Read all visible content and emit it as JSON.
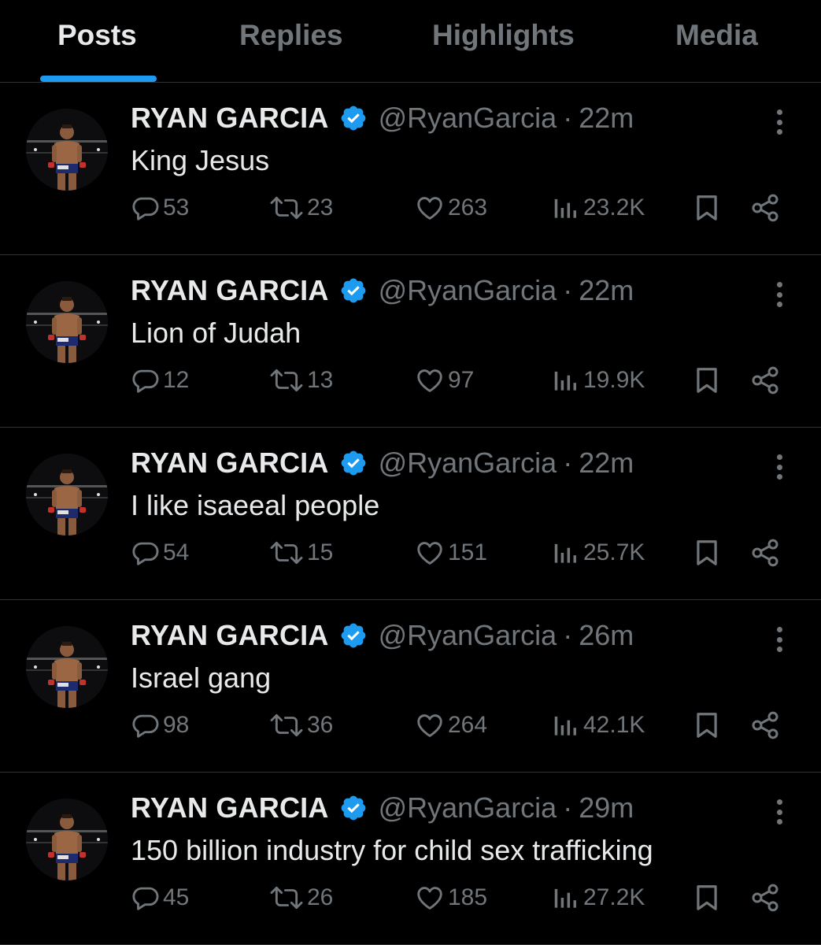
{
  "tabs": [
    {
      "label": "Posts",
      "active": true
    },
    {
      "label": "Replies",
      "active": false
    },
    {
      "label": "Highlights",
      "active": false
    },
    {
      "label": "Media",
      "active": false
    }
  ],
  "colors": {
    "accent": "#1d9bf0",
    "background": "#000000",
    "muted": "#71767b",
    "text": "#e7e9ea"
  },
  "posts": [
    {
      "name": "RYAN GARCIA",
      "handle": "@RyanGarcia",
      "time": "22m",
      "text": "King Jesus",
      "replies": "53",
      "reposts": "23",
      "likes": "263",
      "views": "23.2K"
    },
    {
      "name": "RYAN GARCIA",
      "handle": "@RyanGarcia",
      "time": "22m",
      "text": "Lion of Judah",
      "replies": "12",
      "reposts": "13",
      "likes": "97",
      "views": "19.9K"
    },
    {
      "name": "RYAN GARCIA",
      "handle": "@RyanGarcia",
      "time": "22m",
      "text": "I like isaeeal people",
      "replies": "54",
      "reposts": "15",
      "likes": "151",
      "views": "25.7K"
    },
    {
      "name": "RYAN GARCIA",
      "handle": "@RyanGarcia",
      "time": "26m",
      "text": "Israel gang",
      "replies": "98",
      "reposts": "36",
      "likes": "264",
      "views": "42.1K"
    },
    {
      "name": "RYAN GARCIA",
      "handle": "@RyanGarcia",
      "time": "29m",
      "text": "150 billion industry for child sex trafficking",
      "replies": "45",
      "reposts": "26",
      "likes": "185",
      "views": "27.2K"
    }
  ],
  "icons": {
    "reply": "reply-icon",
    "repost": "repost-icon",
    "like": "heart-icon",
    "views": "views-icon",
    "bookmark": "bookmark-icon",
    "share": "share-icon",
    "more": "more-icon",
    "verified": "verified-badge-icon"
  }
}
